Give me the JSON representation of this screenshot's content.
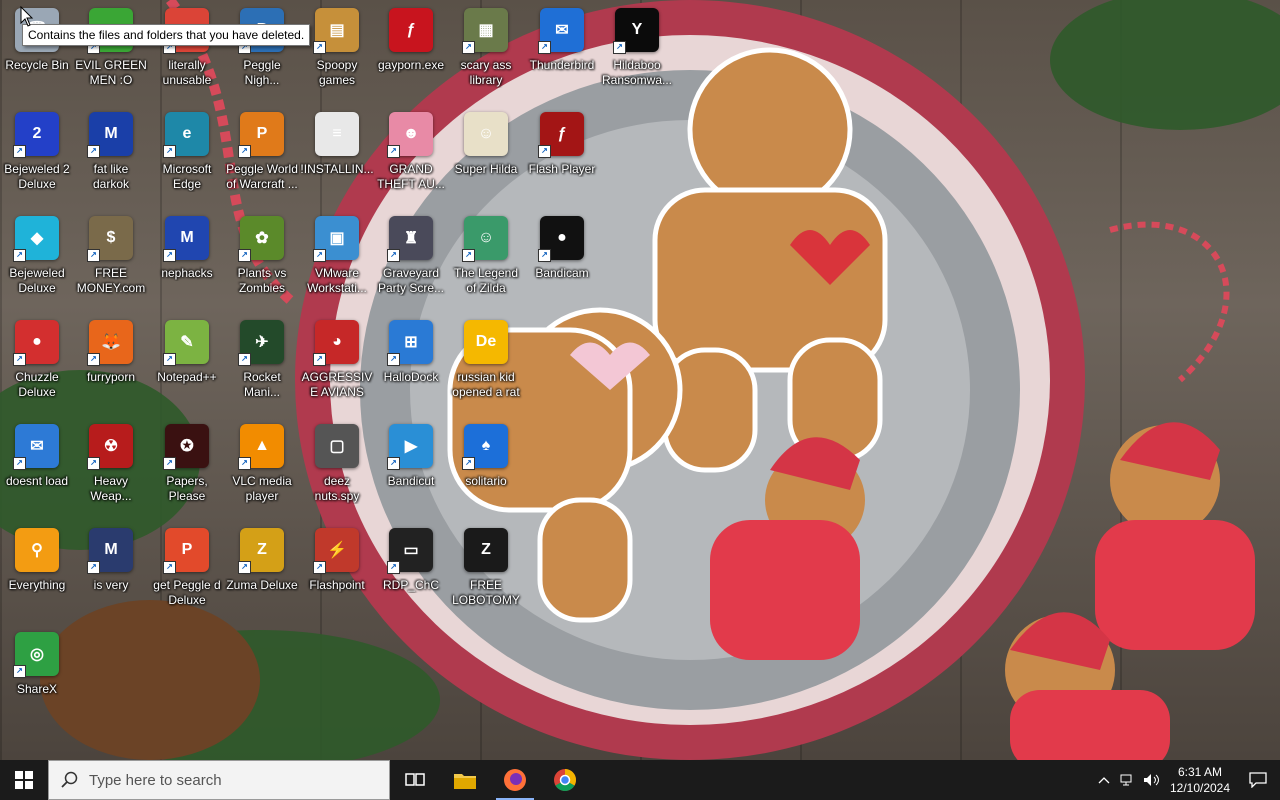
{
  "tooltip": "Contains the files and folders that you have deleted.",
  "desktop_icons": [
    {
      "label": "Recycle Bin",
      "color": "#9aa7b5",
      "glyph": "🗑",
      "shortcut": false
    },
    {
      "label": "Bejeweled 2 Deluxe",
      "color": "#2340c8",
      "glyph": "2",
      "shortcut": true
    },
    {
      "label": "Bejeweled Deluxe",
      "color": "#1fb3d9",
      "glyph": "◆",
      "shortcut": true
    },
    {
      "label": "Chuzzle Deluxe",
      "color": "#d32f2f",
      "glyph": "●",
      "shortcut": true
    },
    {
      "label": "doesnt load",
      "color": "#2d7ad6",
      "glyph": "✉",
      "shortcut": true
    },
    {
      "label": "Everything",
      "color": "#f39c12",
      "glyph": "⚲",
      "shortcut": false
    },
    {
      "label": "ShareX",
      "color": "#2ea043",
      "glyph": "◎",
      "shortcut": true
    },
    {
      "label": "EVIL GREEN MEN :O",
      "color": "#3aa635",
      "glyph": "☺",
      "shortcut": true
    },
    {
      "label": "fat like darkok",
      "color": "#1a3fa8",
      "glyph": "M",
      "shortcut": true
    },
    {
      "label": "FREE MONEY.com",
      "color": "#7a6a4a",
      "glyph": "$",
      "shortcut": true
    },
    {
      "label": "furryporn",
      "color": "#e8661b",
      "glyph": "🦊",
      "shortcut": true
    },
    {
      "label": "Heavy Weap...",
      "color": "#b71c1c",
      "glyph": "☢",
      "shortcut": true
    },
    {
      "label": "is very",
      "color": "#2a3b6e",
      "glyph": "M",
      "shortcut": true
    },
    {
      "label": "literally unusable",
      "color": "#db4437",
      "glyph": "◉",
      "shortcut": true
    },
    {
      "label": "Microsoft Edge",
      "color": "#1e88a8",
      "glyph": "e",
      "shortcut": true
    },
    {
      "label": "nephacks",
      "color": "#2046b0",
      "glyph": "M",
      "shortcut": true
    },
    {
      "label": "Notepad++",
      "color": "#7cb342",
      "glyph": "✎",
      "shortcut": true
    },
    {
      "label": "Papers, Please",
      "color": "#3a1111",
      "glyph": "✪",
      "shortcut": true
    },
    {
      "label": "get Peggle d Deluxe",
      "color": "#e24a2b",
      "glyph": "P",
      "shortcut": true
    },
    {
      "label": "Peggle Nigh...",
      "color": "#2c6fb5",
      "glyph": "P",
      "shortcut": true
    },
    {
      "label": "Peggle World of Warcraft ...",
      "color": "#e07a1a",
      "glyph": "P",
      "shortcut": true
    },
    {
      "label": "Plants vs Zombies",
      "color": "#5b8a2a",
      "glyph": "✿",
      "shortcut": true
    },
    {
      "label": "Rocket Mani...",
      "color": "#234a2a",
      "glyph": "✈",
      "shortcut": true
    },
    {
      "label": "VLC media player",
      "color": "#f28c00",
      "glyph": "▲",
      "shortcut": true
    },
    {
      "label": "Zuma Deluxe",
      "color": "#d4a017",
      "glyph": "Z",
      "shortcut": true
    },
    {
      "label": "Spoopy games",
      "color": "#c6903a",
      "glyph": "▤",
      "shortcut": true
    },
    {
      "label": "!INSTALLIN...",
      "color": "#e8e8e8",
      "glyph": "≡",
      "shortcut": false
    },
    {
      "label": "VMware Workstati...",
      "color": "#3b8fd1",
      "glyph": "▣",
      "shortcut": true
    },
    {
      "label": "AGGRESSIVE AVIANS",
      "color": "#c62828",
      "glyph": "◕",
      "shortcut": true
    },
    {
      "label": "deez nuts.spy",
      "color": "#555555",
      "glyph": "▢",
      "shortcut": false
    },
    {
      "label": "Flashpoint",
      "color": "#c0392b",
      "glyph": "⚡",
      "shortcut": true
    },
    {
      "label": "gayporn.exe",
      "color": "#c8141e",
      "glyph": "ƒ",
      "shortcut": false
    },
    {
      "label": "GRAND THEFT AU...",
      "color": "#e88aa6",
      "glyph": "☻",
      "shortcut": true
    },
    {
      "label": "Graveyard Party Scre...",
      "color": "#4a4a5a",
      "glyph": "♜",
      "shortcut": true
    },
    {
      "label": "HalloDock",
      "color": "#2a7ad5",
      "glyph": "⊞",
      "shortcut": true
    },
    {
      "label": "Bandicut",
      "color": "#2a8fd6",
      "glyph": "▶",
      "shortcut": true
    },
    {
      "label": "RDP_ChC",
      "color": "#222222",
      "glyph": "▭",
      "shortcut": true
    },
    {
      "label": "scary ass library",
      "color": "#6a7a4a",
      "glyph": "▦",
      "shortcut": true
    },
    {
      "label": "Super Hilda",
      "color": "#e8e0c8",
      "glyph": "☺",
      "shortcut": false
    },
    {
      "label": "The Legend of Zilda",
      "color": "#3a9a6a",
      "glyph": "☺",
      "shortcut": true
    },
    {
      "label": "russian kid opened a rat",
      "color": "#f5b800",
      "glyph": "De",
      "shortcut": false
    },
    {
      "label": "solitario",
      "color": "#1c6fd9",
      "glyph": "♠",
      "shortcut": true
    },
    {
      "label": "FREE LOBOTOMYS",
      "color": "#1a1a1a",
      "glyph": "Z",
      "shortcut": false
    },
    {
      "label": "Thunderbird",
      "color": "#1f6fd6",
      "glyph": "✉",
      "shortcut": true
    },
    {
      "label": "Flash Player",
      "color": "#a31515",
      "glyph": "ƒ",
      "shortcut": true
    },
    {
      "label": "Bandicam",
      "color": "#111111",
      "glyph": "●",
      "shortcut": true
    },
    {
      "label": "Hildaboo Ransomwa...",
      "color": "#0b0b0b",
      "glyph": "Y",
      "shortcut": true
    }
  ],
  "taskbar": {
    "search_placeholder": "Type here to search",
    "clock_time": "6:31 AM",
    "clock_date": "12/10/2024"
  }
}
